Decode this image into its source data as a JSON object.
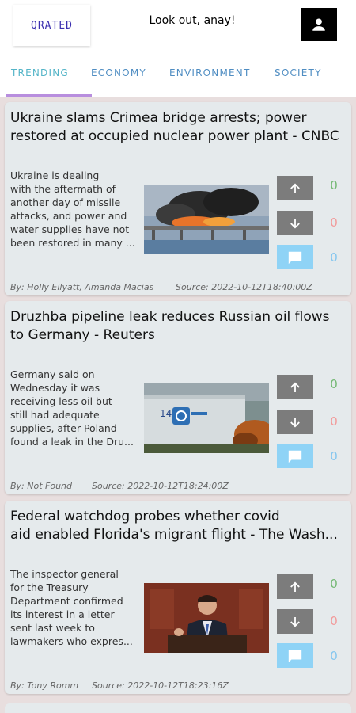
{
  "header": {
    "logo_text": "QRATED",
    "greeting": "Look out, anay!",
    "profile_icon": "person-icon"
  },
  "tabs": [
    {
      "label": "TRENDING",
      "active": true
    },
    {
      "label": "ECONOMY",
      "active": false
    },
    {
      "label": "ENVIRONMENT",
      "active": false
    },
    {
      "label": "SOCIETY",
      "active": false
    }
  ],
  "colors": {
    "accent": "#b88ede",
    "tab_text": "#4f8dc2",
    "upvote": "#73b873",
    "downvote": "#f29a9a",
    "comment": "#84c6ef"
  },
  "articles": [
    {
      "title": "Ukraine slams Crimea bridge arrests; power\nrestored at occupied nuclear power plant - CNBC",
      "summary": "Ukraine is dealing\nwith the aftermath of\nanother day of missile\nattacks, and power and\nwater supplies have not\nbeen restored in many ...",
      "byline": "By: Holly Ellyatt, Amanda Macias",
      "source": "Source: 2022-10-12T18:40:00Z",
      "upvotes": "0",
      "downvotes": "0",
      "comments": "0",
      "image": "burning-bridge-photo"
    },
    {
      "title": "Druzhba pipeline leak reduces Russian oil flows\nto Germany - Reuters",
      "summary": "Germany said on\nWednesday it was\nreceiving less oil but\nstill had adequate\nsupplies, after Poland\nfound a leak in the Dru...",
      "byline": "By: Not Found",
      "source": "Source: 2022-10-12T18:24:00Z",
      "upvotes": "0",
      "downvotes": "0",
      "comments": "0",
      "image": "oil-storage-tank-photo"
    },
    {
      "title": "Federal watchdog probes whether covid\naid enabled Florida's migrant flight - The Wash...",
      "summary": "The inspector general\nfor the Treasury\nDepartment confirmed\nits interest in a letter\nsent last week to\nlawmakers who expres...",
      "byline": "By: Tony Romm",
      "source": "Source: 2022-10-12T18:23:16Z",
      "upvotes": "0",
      "downvotes": "0",
      "comments": "0",
      "image": "politician-at-podium-photo"
    }
  ]
}
